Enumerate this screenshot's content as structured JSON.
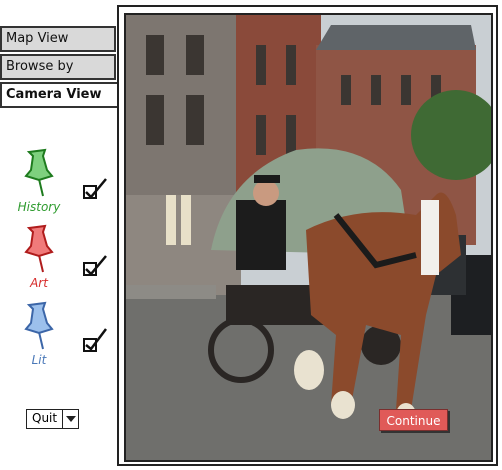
{
  "nav": {
    "map_view": "Map View",
    "browse_photos": "Browse by Photos",
    "camera_view": "Camera View"
  },
  "filters": [
    {
      "label": "History",
      "color": "#2e9b2e",
      "checked": true,
      "icon": "pushpin-icon"
    },
    {
      "label": "Art",
      "color": "#d62a2a",
      "checked": true,
      "icon": "pushpin-icon"
    },
    {
      "label": "Lit",
      "color": "#4a78b8",
      "checked": true,
      "icon": "pushpin-icon"
    }
  ],
  "quit": {
    "label": "Quit"
  },
  "continue": {
    "label": "Continue"
  }
}
